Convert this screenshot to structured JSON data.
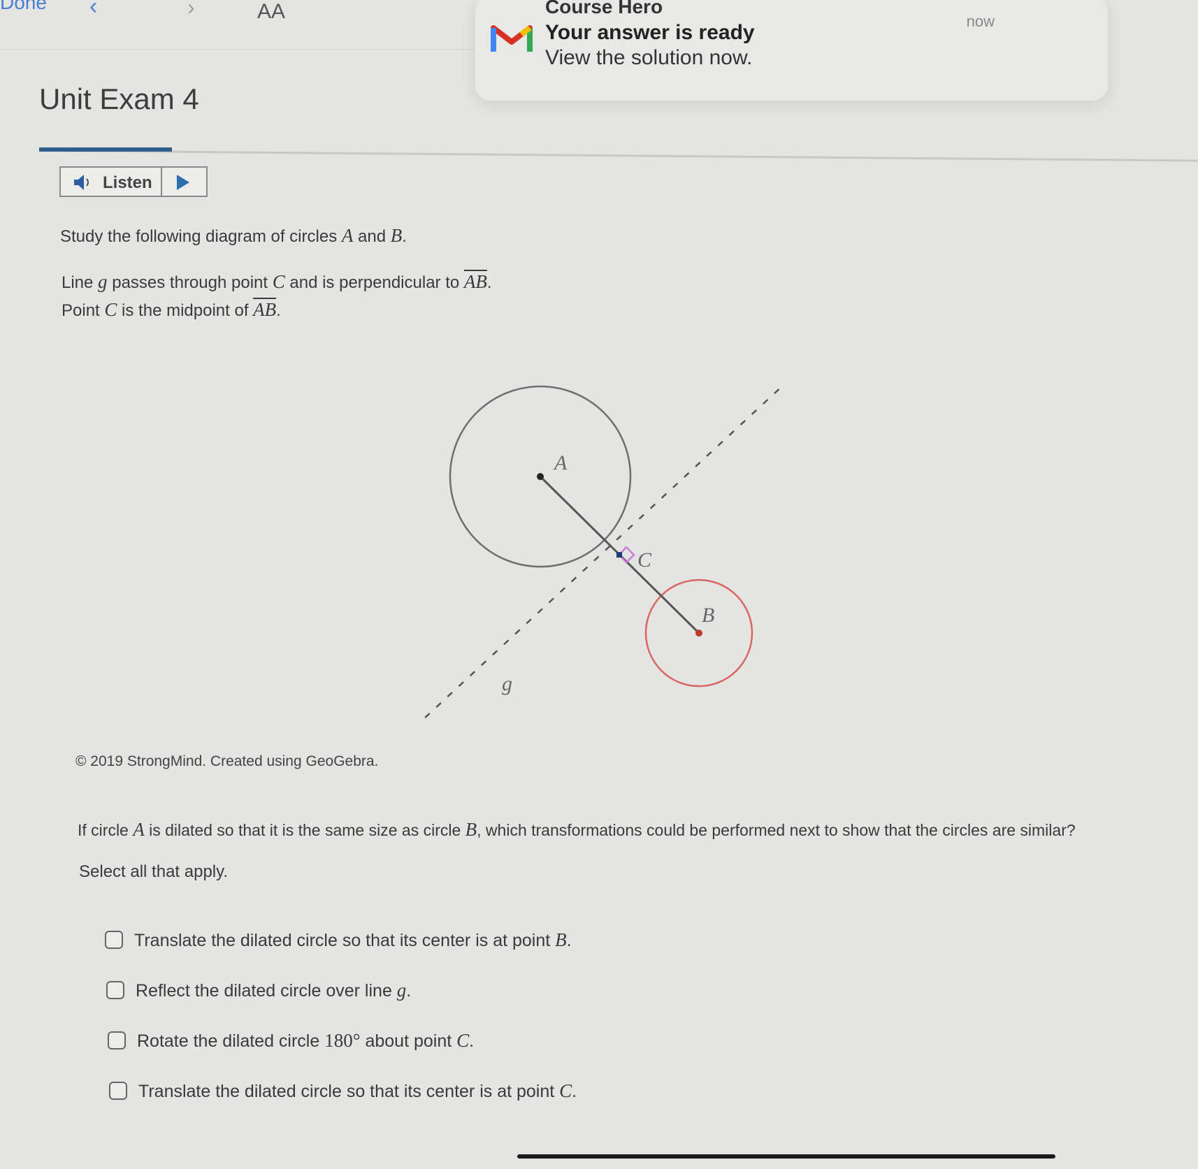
{
  "browser": {
    "done_label": "Done",
    "back_glyph": "‹",
    "forward_glyph": "›",
    "text_size_label": "AA"
  },
  "notification": {
    "app_name": "Course Hero",
    "title": "Your answer is ready",
    "body": "View the solution now.",
    "time": "now",
    "logo_icon": "gmail-m-icon"
  },
  "exam": {
    "title": "Unit Exam 4",
    "progress_fraction": 0.11
  },
  "listen": {
    "label": "Listen",
    "speaker_icon": "speaker-icon",
    "play_icon": "play-icon"
  },
  "prompt": {
    "intro_pre": "Study the following diagram of circles ",
    "intro_a": "A",
    "intro_mid": " and ",
    "intro_b": "B",
    "intro_end": ".",
    "line1_pre": "Line ",
    "line1_g": "g",
    "line1_mid": " passes through point ",
    "line1_c": "C",
    "line1_mid2": " and is perpendicular to ",
    "line1_ab": "AB",
    "line1_end": ".",
    "line2_pre": "Point ",
    "line2_c": "C",
    "line2_mid": " is the midpoint of ",
    "line2_ab": "AB",
    "line2_end": "."
  },
  "diagram": {
    "labels": {
      "A": "A",
      "B": "B",
      "C": "C",
      "g": "g"
    },
    "colors": {
      "circle_a": "#6e6e6e",
      "circle_b": "#d9665f",
      "right_angle": "#c77dd8",
      "point_c": "#1f3f7a"
    },
    "credit": "© 2019 StrongMind. Created using GeoGebra."
  },
  "question": {
    "text_pre": "If circle ",
    "text_a": "A",
    "text_mid": " is dilated so that it is the same size as circle ",
    "text_b": "B",
    "text_end": ", which transformations could be performed next to show that the circles are similar?",
    "instruction": "Select all that apply."
  },
  "options": [
    {
      "pre": "Translate the dilated circle so that its center is at point ",
      "math": "B",
      "end": ".",
      "checked": false
    },
    {
      "pre": "Reflect the dilated circle over line ",
      "math": "g",
      "end": ".",
      "checked": false
    },
    {
      "pre": "Rotate the dilated circle ",
      "math": "180°",
      "post": " about point ",
      "math2": "C",
      "end": ".",
      "checked": false
    },
    {
      "pre": "Translate the dilated circle so that its center is at point ",
      "math": "C",
      "end": ".",
      "checked": false
    }
  ]
}
